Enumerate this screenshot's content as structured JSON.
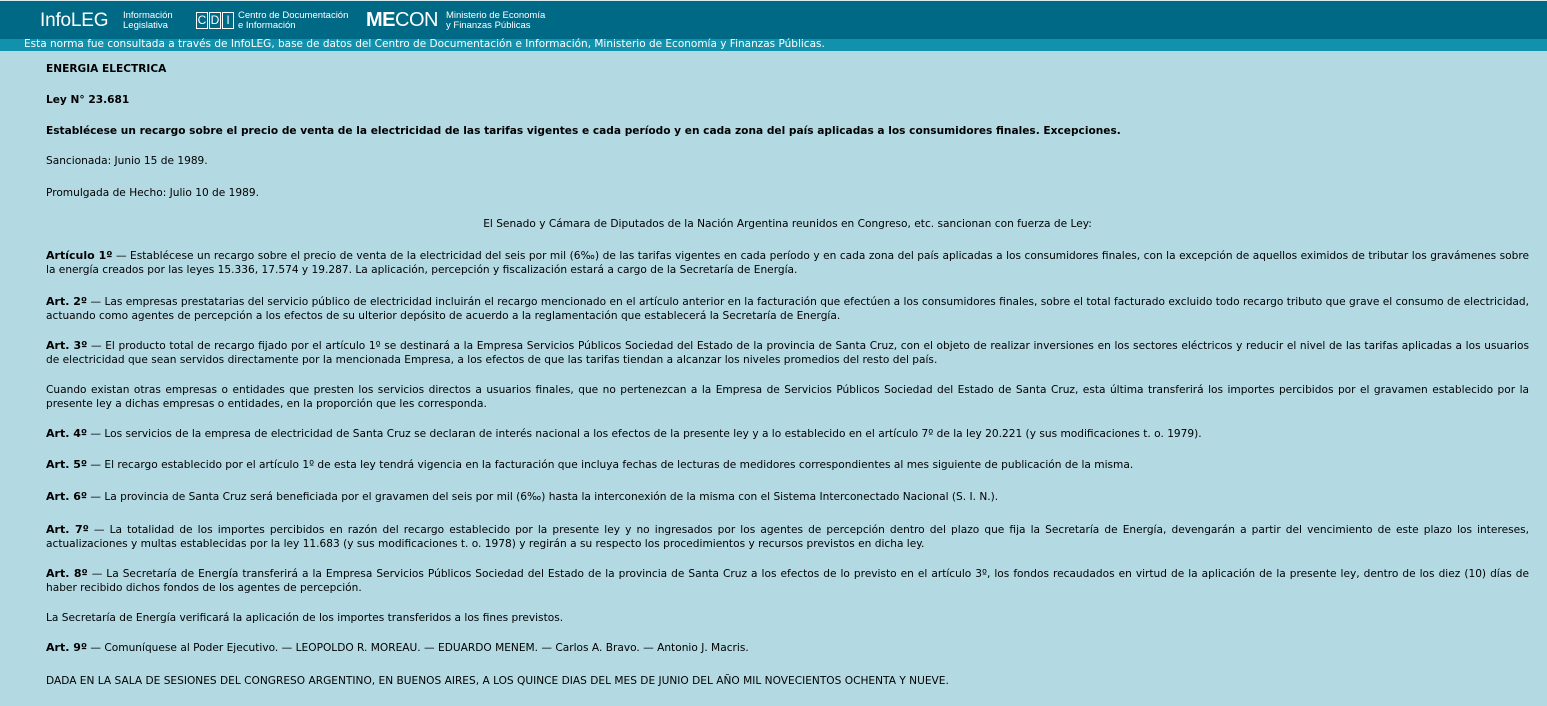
{
  "header": {
    "infoleg_logo": "InfoLEG",
    "infoleg_sub1": "Información",
    "infoleg_sub2": "Legislativa",
    "cdi_letters": [
      "C",
      "D",
      "I"
    ],
    "cdi_sub1": "Centro de Documentación",
    "cdi_sub2": "e Información",
    "mecon_logo_bold": "ME",
    "mecon_logo_rest": "CON",
    "mecon_sub1": "Ministerio de Economía",
    "mecon_sub2": "y Finanzas Públicas",
    "notice": "Esta norma fue consultada a través de InfoLEG, base de datos del Centro de Documentación e Información,  Ministerio de Economía y Finanzas Públicas."
  },
  "colors": {
    "topbar": "#006a86",
    "lightbar": "#1291ad",
    "background": "#b3d9e3"
  },
  "document": {
    "subject": "ENERGIA ELECTRICA",
    "law_number": "Ley N° 23.681",
    "summary": "Establécese un recargo sobre el precio de venta de la electricidad de las tarifas vigentes e cada período y en cada zona del país aplicadas a los consumidores finales. Excepciones.",
    "sanctioned": "Sancionada: Junio 15 de 1989.",
    "promulgated": "Promulgada de Hecho: Julio 10 de 1989.",
    "preamble": "El Senado y Cámara de Diputados de la Nación Argentina reunidos en Congreso, etc. sancionan con fuerza de Ley:",
    "art1_label": "Artículo 1º",
    "art1_text": " — Establécese un recargo sobre el precio de venta de la electricidad del seis por mil (6‰) de las tarifas vigentes en cada período y en cada zona del país aplicadas a los consumidores finales, con la excepción de aquellos eximidos de tributar los gravámenes sobre la energía creados por las leyes 15.336, 17.574 y 19.287. La aplicación, percepción y fiscalización estará a cargo de la Secretaría de Energía.",
    "art2_label": "Art. 2º",
    "art2_text": " — Las empresas prestatarias del servicio público de electricidad incluirán el recargo mencionado en el artículo anterior en la facturación que efectúen a los consumidores finales, sobre el total facturado excluido todo recargo tributo que grave el consumo de electricidad, actuando como agentes de percepción a los efectos de su ulterior depósito de acuerdo a la reglamentación que establecerá la Secretaría de Energía.",
    "art3_label": "Art. 3º",
    "art3_text": " — El producto total de recargo fijado por el artículo 1º se destinará a la Empresa Servicios Públicos Sociedad del Estado de la provincia de Santa Cruz, con el objeto de realizar inversiones en los sectores eléctricos y reducir el nivel de las tarifas aplicadas a los usuarios de electricidad que sean servidos directamente por la mencionada Empresa, a los efectos de que las tarifas tiendan a alcanzar los niveles promedios del resto del país.",
    "art3_cont": "Cuando existan otras empresas o entidades que presten los servicios directos a usuarios finales, que no pertenezcan a la Empresa de Servicios Públicos Sociedad del Estado de Santa Cruz, esta última transferirá los importes percibidos por el gravamen establecido por la presente ley a dichas empresas o entidades, en la proporción que les corresponda.",
    "art4_label": "Art. 4º",
    "art4_text": " — Los servicios de la empresa de electricidad de Santa Cruz se declaran de interés nacional a los efectos de la presente ley y a lo establecido en el artículo 7º de la ley 20.221 (y sus modificaciones t. o. 1979).",
    "art5_label": "Art. 5º",
    "art5_text": " — El recargo establecido por el artículo 1º de esta ley tendrá vigencia en la facturación que incluya fechas de lecturas de medidores correspondientes al mes siguiente de publicación de la misma.",
    "art6_label": "Art. 6º",
    "art6_text": " — La provincia de Santa Cruz será beneficiada por el gravamen del seis por mil (6‰) hasta la interconexión de la misma con el Sistema Interconectado Nacional (S. I. N.).",
    "art7_label": "Art. 7º",
    "art7_text": " — La totalidad de los importes percibidos en razón del recargo establecido por la presente ley y no ingresados por los agentes de percepción dentro del plazo que fija la Secretaría de Energía, devengarán a partir del vencimiento de este plazo los intereses, actualizaciones y multas establecidas por la ley 11.683 (y sus modificaciones t. o. 1978) y regirán a su respecto los procedimientos y recursos previstos en dicha ley.",
    "art8_label": "Art. 8º",
    "art8_text": " — La Secretaría de Energía transferirá a la Empresa Servicios Públicos Sociedad del Estado de la provincia de Santa Cruz a los efectos de lo previsto en el artículo 3º, los fondos recaudados en virtud de la aplicación de la presente ley, dentro de los diez (10) días de haber recibido dichos fondos de los agentes de percepción.",
    "art8_cont": "La Secretaría de Energía verificará la aplicación de los importes transferidos a los fines previstos.",
    "art9_label": "Art. 9º",
    "art9_text": " — Comuníquese al Poder Ejecutivo. — LEOPOLDO R. MOREAU. — EDUARDO MENEM. — Carlos A. Bravo. — Antonio J. Macris.",
    "closing": "DADA EN LA SALA DE SESIONES DEL CONGRESO ARGENTINO, EN BUENOS AIRES, A LOS QUINCE DIAS DEL MES DE JUNIO DEL AÑO MIL NOVECIENTOS OCHENTA Y NUEVE."
  }
}
